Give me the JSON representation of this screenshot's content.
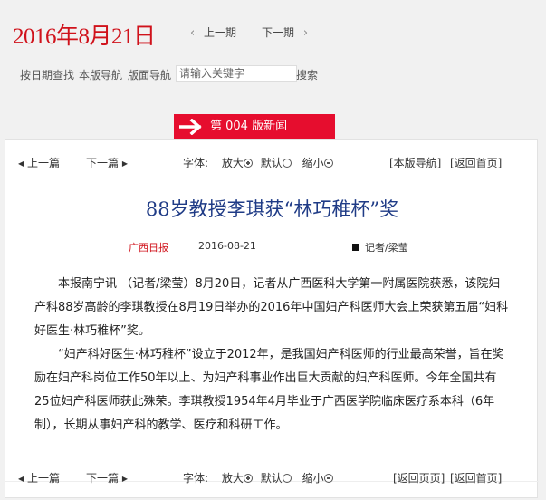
{
  "header": {
    "date": "2016年8月21日",
    "prev_issue": "上一期",
    "next_issue": "下一期"
  },
  "toolbar": {
    "by_date": "按日期查找",
    "edition_nav": "本版导航",
    "page_nav": "版面导航",
    "search_placeholder": "请输入关键字",
    "search_button": "搜索"
  },
  "banner": {
    "label": "第 004 版新闻"
  },
  "article_nav": {
    "prev_article": "上一篇",
    "next_article": "下一篇",
    "font_label": "字体:",
    "font_large": "放大",
    "font_default": "默认",
    "font_small": "缩小",
    "edition_nav_link": "[本版导航]",
    "back_to_top": "[返回首页]",
    "back_to_page": "[返回页页]"
  },
  "article": {
    "title": "88岁教授李琪获“林巧稚杯”奖",
    "source": "广西日报",
    "date": "2016-08-21",
    "author": "记者/梁莹",
    "paragraphs": [
      "本报南宁讯 （记者/梁莹）8月20日，记者从广西医科大学第一附属医院获悉，该院妇产科88岁高龄的李琪教授在8月19日举办的2016年中国妇产科医师大会上荣获第五届“妇科好医生·林巧稚杯”奖。",
      "“妇产科好医生·林巧稚杯”设立于2012年，是我国妇产科医师的行业最高荣誉，旨在奖励在妇产科岗位工作50年以上、为妇产科事业作出巨大贡献的妇产科医师。今年全国共有25位妇产科医师获此殊荣。李琪教授1954年4月毕业于广西医学院临床医疗系本科（6年制），长期从事妇产科的教学、医疗和科研工作。"
    ]
  },
  "colors": {
    "accent_red": "#d0121b",
    "banner_red": "#e60d2e",
    "headline_blue": "#1f3b86"
  }
}
